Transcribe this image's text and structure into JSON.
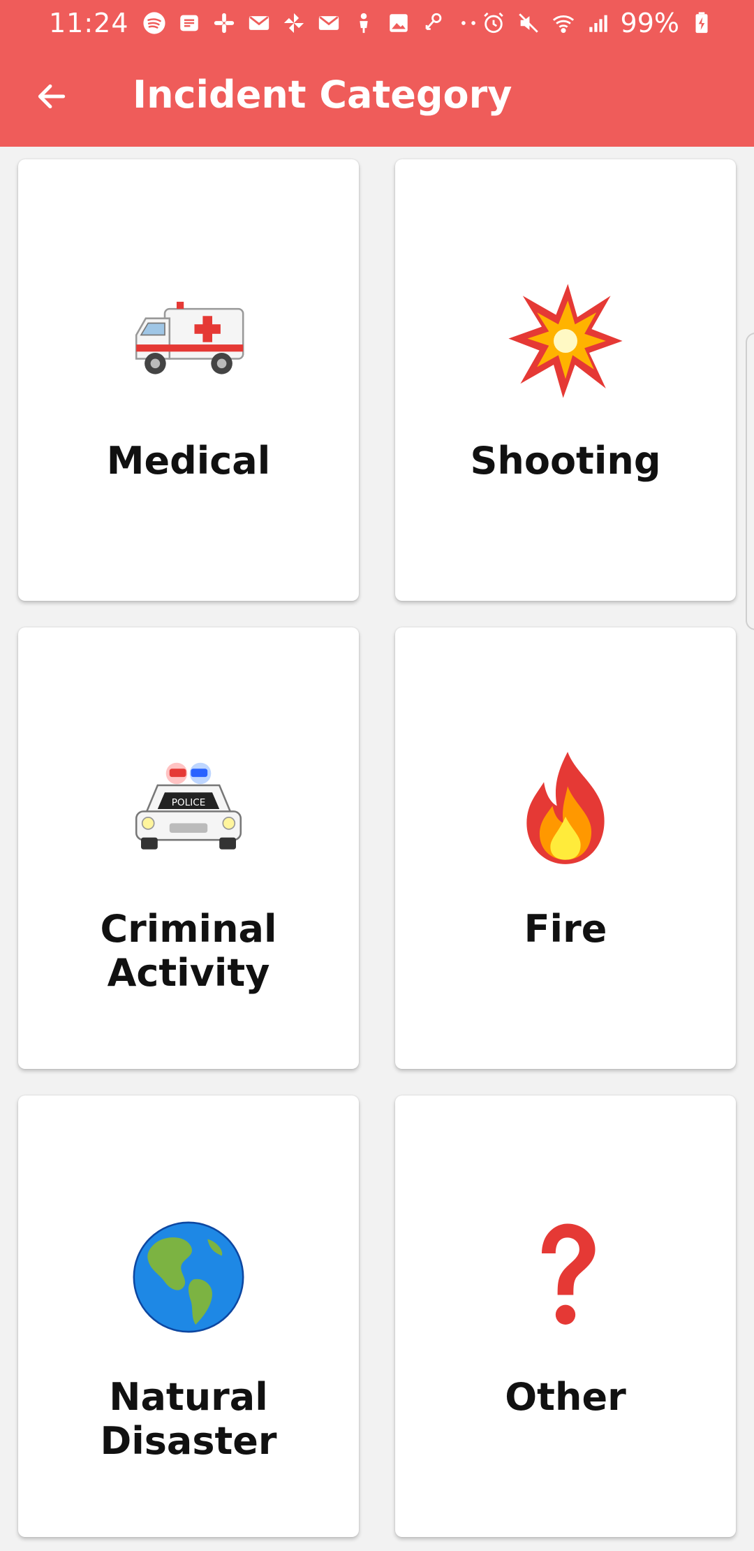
{
  "status_bar": {
    "time": "11:24",
    "battery": "99%",
    "notification_icons": [
      "spotify-icon",
      "message-icon",
      "slack-icon",
      "gmail-icon",
      "pinwheel-icon",
      "gmail-icon",
      "person-icon",
      "image-icon",
      "link-icon",
      "more-dots-icon"
    ],
    "right_icons": [
      "alarm-icon",
      "mute-icon",
      "wifi-icon",
      "signal-icon",
      "battery-charging-icon"
    ]
  },
  "appbar": {
    "title": "Incident Category",
    "back_icon": "arrow-back-icon",
    "color": "#ef5c5a"
  },
  "categories": [
    {
      "label": "Medical",
      "icon": "ambulance-icon"
    },
    {
      "label": "Shooting",
      "icon": "collision-icon"
    },
    {
      "label": "Criminal Activity",
      "icon": "police-car-icon"
    },
    {
      "label": "Fire",
      "icon": "fire-icon"
    },
    {
      "label": "Natural Disaster",
      "icon": "globe-icon"
    },
    {
      "label": "Other",
      "icon": "question-mark-icon"
    }
  ]
}
